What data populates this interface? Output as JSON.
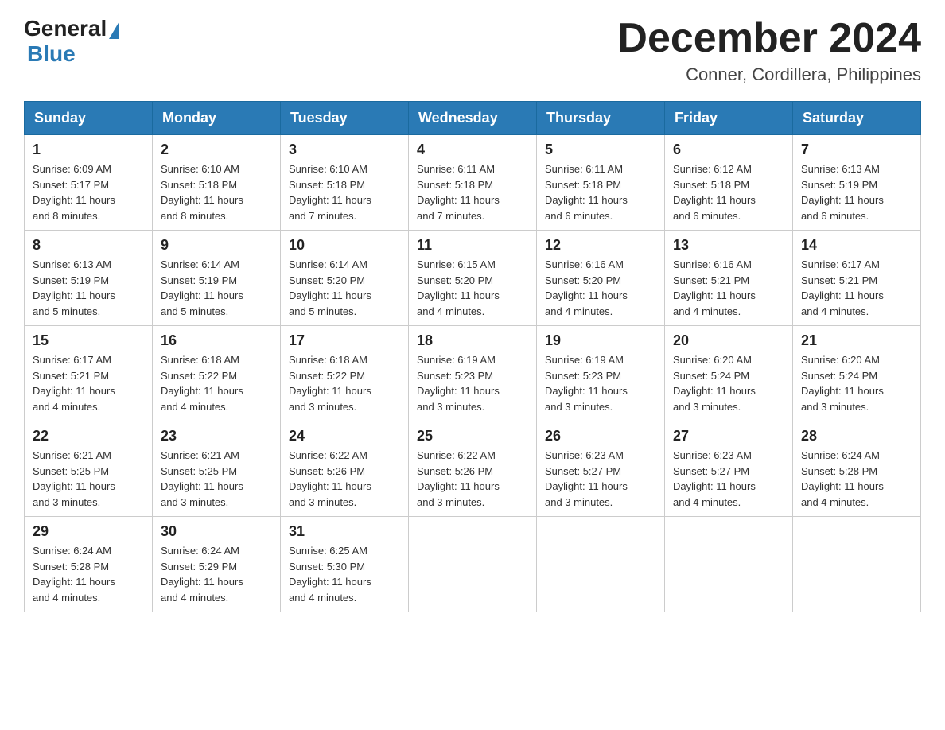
{
  "logo": {
    "general": "General",
    "triangle": "▲",
    "blue": "Blue"
  },
  "title": {
    "month_year": "December 2024",
    "location": "Conner, Cordillera, Philippines"
  },
  "weekdays": [
    "Sunday",
    "Monday",
    "Tuesday",
    "Wednesday",
    "Thursday",
    "Friday",
    "Saturday"
  ],
  "weeks": [
    [
      {
        "day": "1",
        "sunrise": "6:09 AM",
        "sunset": "5:17 PM",
        "daylight": "11 hours and 8 minutes."
      },
      {
        "day": "2",
        "sunrise": "6:10 AM",
        "sunset": "5:18 PM",
        "daylight": "11 hours and 8 minutes."
      },
      {
        "day": "3",
        "sunrise": "6:10 AM",
        "sunset": "5:18 PM",
        "daylight": "11 hours and 7 minutes."
      },
      {
        "day": "4",
        "sunrise": "6:11 AM",
        "sunset": "5:18 PM",
        "daylight": "11 hours and 7 minutes."
      },
      {
        "day": "5",
        "sunrise": "6:11 AM",
        "sunset": "5:18 PM",
        "daylight": "11 hours and 6 minutes."
      },
      {
        "day": "6",
        "sunrise": "6:12 AM",
        "sunset": "5:18 PM",
        "daylight": "11 hours and 6 minutes."
      },
      {
        "day": "7",
        "sunrise": "6:13 AM",
        "sunset": "5:19 PM",
        "daylight": "11 hours and 6 minutes."
      }
    ],
    [
      {
        "day": "8",
        "sunrise": "6:13 AM",
        "sunset": "5:19 PM",
        "daylight": "11 hours and 5 minutes."
      },
      {
        "day": "9",
        "sunrise": "6:14 AM",
        "sunset": "5:19 PM",
        "daylight": "11 hours and 5 minutes."
      },
      {
        "day": "10",
        "sunrise": "6:14 AM",
        "sunset": "5:20 PM",
        "daylight": "11 hours and 5 minutes."
      },
      {
        "day": "11",
        "sunrise": "6:15 AM",
        "sunset": "5:20 PM",
        "daylight": "11 hours and 4 minutes."
      },
      {
        "day": "12",
        "sunrise": "6:16 AM",
        "sunset": "5:20 PM",
        "daylight": "11 hours and 4 minutes."
      },
      {
        "day": "13",
        "sunrise": "6:16 AM",
        "sunset": "5:21 PM",
        "daylight": "11 hours and 4 minutes."
      },
      {
        "day": "14",
        "sunrise": "6:17 AM",
        "sunset": "5:21 PM",
        "daylight": "11 hours and 4 minutes."
      }
    ],
    [
      {
        "day": "15",
        "sunrise": "6:17 AM",
        "sunset": "5:21 PM",
        "daylight": "11 hours and 4 minutes."
      },
      {
        "day": "16",
        "sunrise": "6:18 AM",
        "sunset": "5:22 PM",
        "daylight": "11 hours and 4 minutes."
      },
      {
        "day": "17",
        "sunrise": "6:18 AM",
        "sunset": "5:22 PM",
        "daylight": "11 hours and 3 minutes."
      },
      {
        "day": "18",
        "sunrise": "6:19 AM",
        "sunset": "5:23 PM",
        "daylight": "11 hours and 3 minutes."
      },
      {
        "day": "19",
        "sunrise": "6:19 AM",
        "sunset": "5:23 PM",
        "daylight": "11 hours and 3 minutes."
      },
      {
        "day": "20",
        "sunrise": "6:20 AM",
        "sunset": "5:24 PM",
        "daylight": "11 hours and 3 minutes."
      },
      {
        "day": "21",
        "sunrise": "6:20 AM",
        "sunset": "5:24 PM",
        "daylight": "11 hours and 3 minutes."
      }
    ],
    [
      {
        "day": "22",
        "sunrise": "6:21 AM",
        "sunset": "5:25 PM",
        "daylight": "11 hours and 3 minutes."
      },
      {
        "day": "23",
        "sunrise": "6:21 AM",
        "sunset": "5:25 PM",
        "daylight": "11 hours and 3 minutes."
      },
      {
        "day": "24",
        "sunrise": "6:22 AM",
        "sunset": "5:26 PM",
        "daylight": "11 hours and 3 minutes."
      },
      {
        "day": "25",
        "sunrise": "6:22 AM",
        "sunset": "5:26 PM",
        "daylight": "11 hours and 3 minutes."
      },
      {
        "day": "26",
        "sunrise": "6:23 AM",
        "sunset": "5:27 PM",
        "daylight": "11 hours and 3 minutes."
      },
      {
        "day": "27",
        "sunrise": "6:23 AM",
        "sunset": "5:27 PM",
        "daylight": "11 hours and 4 minutes."
      },
      {
        "day": "28",
        "sunrise": "6:24 AM",
        "sunset": "5:28 PM",
        "daylight": "11 hours and 4 minutes."
      }
    ],
    [
      {
        "day": "29",
        "sunrise": "6:24 AM",
        "sunset": "5:28 PM",
        "daylight": "11 hours and 4 minutes."
      },
      {
        "day": "30",
        "sunrise": "6:24 AM",
        "sunset": "5:29 PM",
        "daylight": "11 hours and 4 minutes."
      },
      {
        "day": "31",
        "sunrise": "6:25 AM",
        "sunset": "5:30 PM",
        "daylight": "11 hours and 4 minutes."
      },
      null,
      null,
      null,
      null
    ]
  ],
  "labels": {
    "sunrise": "Sunrise:",
    "sunset": "Sunset:",
    "daylight": "Daylight:"
  }
}
